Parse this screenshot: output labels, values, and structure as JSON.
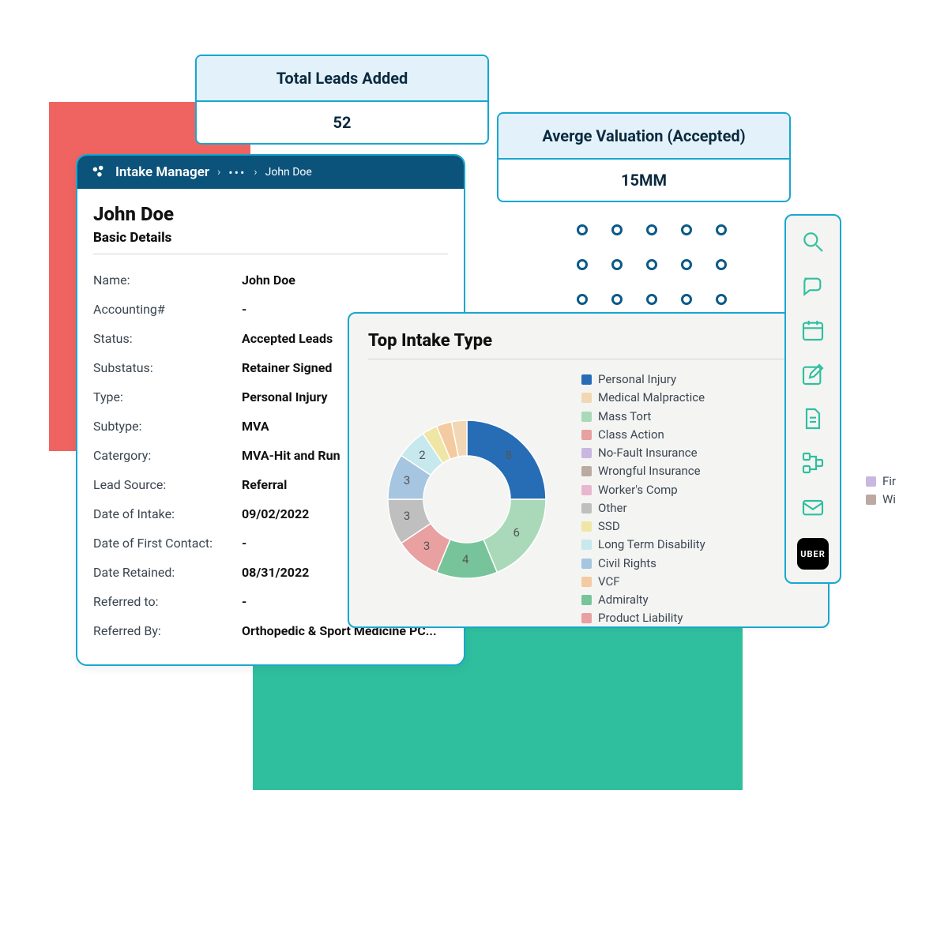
{
  "stats": {
    "leads": {
      "title": "Total Leads Added",
      "value": "52"
    },
    "valuation": {
      "title": "Averge Valuation (Accepted)",
      "value": "15MM"
    }
  },
  "intake": {
    "app_title": "Intake Manager",
    "crumb_current": "John Doe",
    "name_heading": "John Doe",
    "section_heading": "Basic Details",
    "rows": [
      {
        "label": "Name:",
        "value": "John Doe"
      },
      {
        "label": "Accounting#",
        "value": "-"
      },
      {
        "label": "Status:",
        "value": "Accepted Leads"
      },
      {
        "label": "Substatus:",
        "value": "Retainer Signed"
      },
      {
        "label": "Type:",
        "value": "Personal Injury"
      },
      {
        "label": "Subtype:",
        "value": "MVA"
      },
      {
        "label": "Catergory:",
        "value": "MVA-Hit and Run"
      },
      {
        "label": "Lead Source:",
        "value": "Referral"
      },
      {
        "label": "Date of Intake:",
        "value": "09/02/2022"
      },
      {
        "label": "Date of First Contact:",
        "value": "-"
      },
      {
        "label": "Date Retained:",
        "value": "08/31/2022"
      },
      {
        "label": "Referred to:",
        "value": "-"
      },
      {
        "label": "Referred By:",
        "value": "Orthopedic & Sport Medicine PC..."
      }
    ]
  },
  "chart_data": {
    "type": "pie",
    "title": "Top Intake Type",
    "series": [
      {
        "name": "Personal Injury",
        "value": 8,
        "color": "#276db5"
      },
      {
        "name": "Mass Tort",
        "value": 6,
        "color": "#a9d9b8"
      },
      {
        "name": "Admiralty",
        "value": 4,
        "color": "#78c49a"
      },
      {
        "name": "Product Liability",
        "value": 3,
        "color": "#e8a0a1"
      },
      {
        "name": "Other",
        "value": 3,
        "color": "#bfbfbf"
      },
      {
        "name": "Civil Rights",
        "value": 3,
        "color": "#a6c5e0"
      },
      {
        "name": "Long Term Disability",
        "value": 2,
        "color": "#c7e8ec"
      },
      {
        "name": "SSD",
        "value": 1,
        "color": "#efe6a6"
      },
      {
        "name": "VCF",
        "value": 1,
        "color": "#f4caa0"
      },
      {
        "name": "Medical Malpractice",
        "value": 1,
        "color": "#f2d7b4"
      }
    ],
    "legend_order": [
      "Personal Injury",
      "Medical Malpractice",
      "Mass Tort",
      "Class Action",
      "No-Fault Insurance",
      "Wrongful Insurance",
      "Worker's Comp",
      "Other",
      "SSD",
      "Long Term Disability",
      "Civil Rights",
      "VCF",
      "Admiralty",
      "Product Liability"
    ],
    "legend_colors": {
      "Personal Injury": "#276db5",
      "Medical Malpractice": "#f2d7b4",
      "Mass Tort": "#a9d9b8",
      "Class Action": "#e8a0a1",
      "No-Fault Insurance": "#c9b7e2",
      "Wrongful Insurance": "#bca9a1",
      "Worker's Comp": "#e9b6cf",
      "Other": "#bfbfbf",
      "SSD": "#efe6a6",
      "Long Term Disability": "#c7e8ec",
      "Civil Rights": "#a6c5e0",
      "VCF": "#f4caa0",
      "Admiralty": "#78c49a",
      "Product Liability": "#e8a0a1"
    }
  },
  "extra_legend": [
    {
      "label": "Fir",
      "color": "#c9b7e2"
    },
    {
      "label": "Wi",
      "color": "#bca9a1"
    }
  ],
  "iconbar": {
    "uber_label": "UBER"
  }
}
